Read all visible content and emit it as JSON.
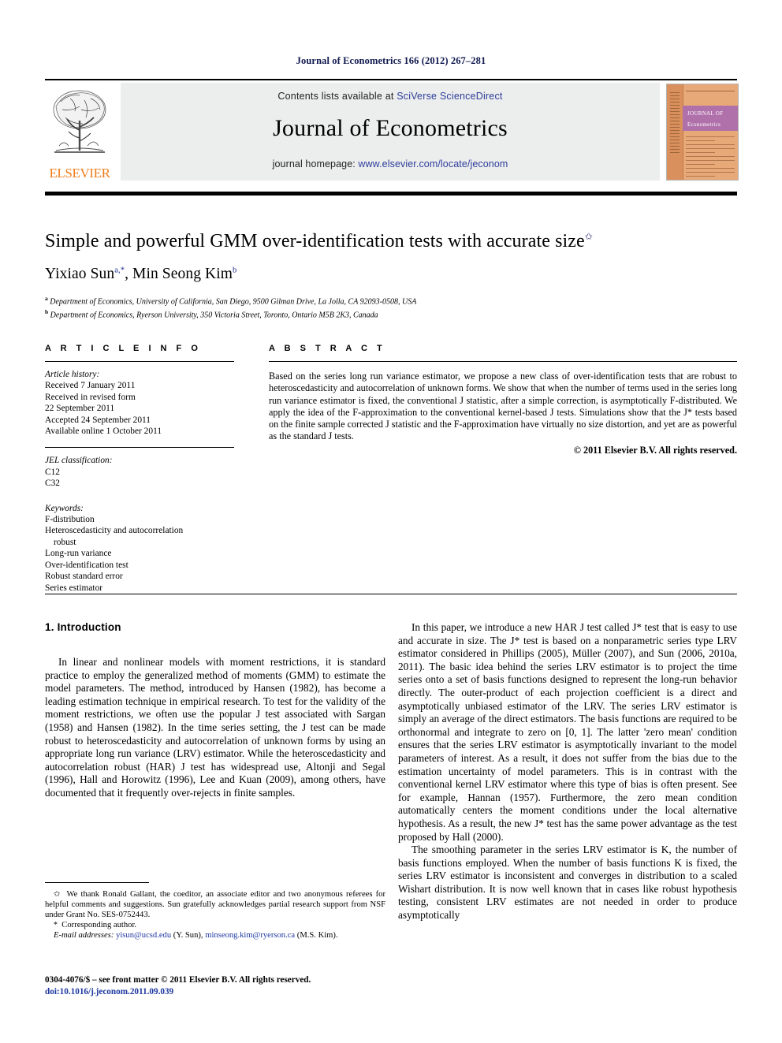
{
  "running_head": "Journal of Econometrics 166 (2012) 267–281",
  "masthead": {
    "contents_prefix": "Contents lists available at ",
    "contents_link": "SciVerse ScienceDirect",
    "journal_title": "Journal of Econometrics",
    "homepage_prefix": "journal homepage: ",
    "homepage_link": "www.elsevier.com/locate/jeconom",
    "publisher_wordmark": "ELSEVIER",
    "cover_title_line1": "JOURNAL OF",
    "cover_title_line2": "Econometrics",
    "accent_link_color": "#2c3e9b",
    "publisher_color": "#f07d1a",
    "cover_band_color": "#b071ab",
    "cover_bg_color": "#e8a979"
  },
  "title": {
    "text": "Simple and powerful GMM over-identification tests with accurate size",
    "footnote_marker": "✩"
  },
  "authors": {
    "line": "Yixiao Sun",
    "author1_name": "Yixiao Sun",
    "author1_sup": "a,*",
    "separator": ", ",
    "author2_name": "Min Seong Kim",
    "author2_sup": "b",
    "affiliations": [
      {
        "marker": "a",
        "text": "Department of Economics, University of California, San Diego, 9500 Gilman Drive, La Jolla, CA 92093-0508, USA"
      },
      {
        "marker": "b",
        "text": "Department of Economics, Ryerson University, 350 Victoria Street, Toronto, Ontario M5B 2K3, Canada"
      }
    ]
  },
  "article_info": {
    "heading": "A R T I C L E    I N F O",
    "history_title": "Article history:",
    "history_lines": [
      "Received 7 January 2011",
      "Received in revised form",
      "22 September 2011",
      "Accepted 24 September 2011",
      "Available online 1 October 2011"
    ],
    "jel_title": "JEL classification:",
    "jel_codes": [
      "C12",
      "C32"
    ],
    "keywords_title": "Keywords:",
    "keywords": [
      "F-distribution",
      "Heteroscedasticity and autocorrelation",
      "robust",
      "Long-run variance",
      "Over-identification test",
      "Robust standard error",
      "Series estimator"
    ]
  },
  "abstract": {
    "heading": "A B S T R A C T",
    "text": "Based on the series long run variance estimator, we propose a new class of over-identification tests that are robust to heteroscedasticity and autocorrelation of unknown forms. We show that when the number of terms used in the series long run variance estimator is fixed, the conventional J statistic, after a simple correction, is asymptotically F-distributed. We apply the idea of the F-approximation to the conventional kernel-based J tests. Simulations show that the J* tests based on the finite sample corrected J statistic and the F-approximation have virtually no size distortion, and yet are as powerful as the standard J tests.",
    "copyright": "© 2011 Elsevier B.V. All rights reserved."
  },
  "body": {
    "section_number_title": "1. Introduction",
    "left_paragraph_1": "In linear and nonlinear models with moment restrictions, it is standard practice to employ the generalized method of moments (GMM) to estimate the model parameters. The method, introduced by Hansen (1982), has become a leading estimation technique in empirical research. To test for the validity of the moment restrictions, we often use the popular J test associated with Sargan (1958) and Hansen (1982). In the time series setting, the J test can be made robust to heteroscedasticity and autocorrelation of unknown forms by using an appropriate long run variance (LRV) estimator. While the heteroscedasticity and autocorrelation robust (HAR) J test has widespread use, Altonji and Segal (1996), Hall and Horowitz (1996), Lee and Kuan (2009), among others, have documented that it frequently over-rejects in finite samples.",
    "right_paragraph_1": "In this paper, we introduce a new HAR J test called J* test that is easy to use and accurate in size. The J* test is based on a nonparametric series type LRV estimator considered in Phillips (2005), Müller (2007), and Sun (2006, 2010a, 2011). The basic idea behind the series LRV estimator is to project the time series onto a set of basis functions designed to represent the long-run behavior directly. The outer-product of each projection coefficient is a direct and asymptotically unbiased estimator of the LRV. The series LRV estimator is simply an average of the direct estimators. The basis functions are required to be orthonormal and integrate to zero on [0, 1]. The latter 'zero mean' condition ensures that the series LRV estimator is asymptotically invariant to the model parameters of interest. As a result, it does not suffer from the bias due to the estimation uncertainty of model parameters. This is in contrast with the conventional kernel LRV estimator where this type of bias is often present. See for example, Hannan (1957). Furthermore, the zero mean condition automatically centers the moment conditions under the local alternative hypothesis. As a result, the new J* test has the same power advantage as the test proposed by Hall (2000).",
    "right_paragraph_2": "The smoothing parameter in the series LRV estimator is K, the number of basis functions employed. When the number of basis functions K is fixed, the series LRV estimator is inconsistent and converges in distribution to a scaled Wishart distribution. It is now well known that in cases like robust hypothesis testing, consistent LRV estimates are not needed in order to produce asymptotically"
  },
  "footnotes": {
    "acknowledgement_marker": "✩",
    "acknowledgement": "We thank Ronald Gallant, the coeditor, an associate editor and two anonymous referees for helpful comments and suggestions. Sun gratefully acknowledges partial research support from NSF under Grant No. SES-0752443.",
    "corresponding_marker": "*",
    "corresponding": "Corresponding author.",
    "email_label": "E-mail addresses:",
    "email1": "yisun@ucsd.edu",
    "email1_owner": "(Y. Sun),",
    "email2": "minseong.kim@ryerson.ca",
    "email2_owner": "(M.S. Kim)."
  },
  "imprint": {
    "issn_line": "0304-4076/$ – see front matter © 2011 Elsevier B.V. All rights reserved.",
    "doi": "doi:10.1016/j.jeconom.2011.09.039"
  }
}
